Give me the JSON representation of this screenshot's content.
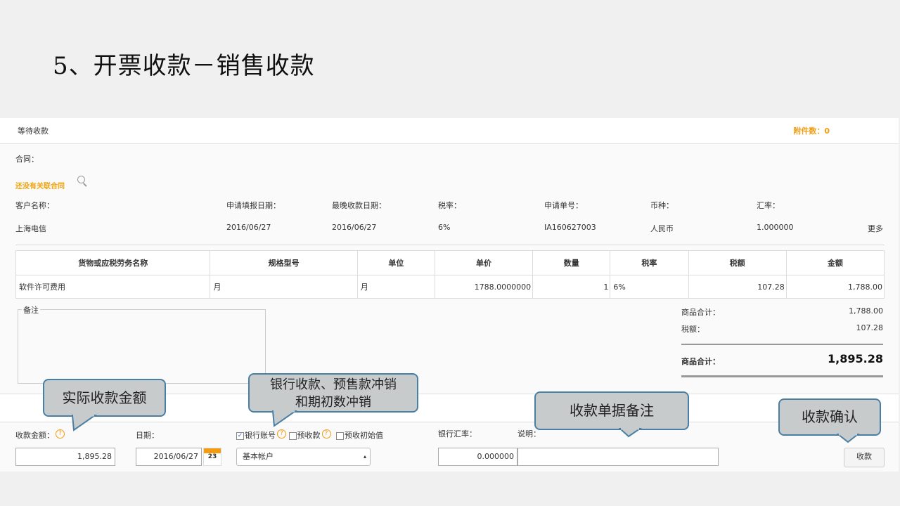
{
  "slide": {
    "title": "5、开票收款－销售收款"
  },
  "header": {
    "status": "等待收款",
    "attachments": "附件数：0"
  },
  "contract": {
    "label": "合同：",
    "link": "还没有关联合同"
  },
  "info": {
    "labels": [
      "客户名称：",
      "申请填报日期：",
      "最晚收款日期：",
      "税率：",
      "申请单号：",
      "币种：",
      "汇率："
    ],
    "values": [
      "上海电信",
      "2016/06/27",
      "2016/06/27",
      "6%",
      "IA160627003",
      "人民币",
      "1.000000"
    ],
    "more": "更多"
  },
  "table": {
    "headers": [
      "货物或应税劳务名称",
      "规格型号",
      "单位",
      "单价",
      "数量",
      "税率",
      "税额",
      "金额"
    ],
    "rows": [
      [
        "软件许可费用",
        "月",
        "月",
        "1788.0000000",
        "1",
        "6%",
        "107.28",
        "1,788.00"
      ]
    ]
  },
  "memo": {
    "label": "备注"
  },
  "summary": {
    "goods_label": "商品合计：",
    "goods_value": "1,788.00",
    "tax_label": "税额：",
    "tax_value": "107.28",
    "total_label": "商品合计：",
    "total_value": "1,895.28"
  },
  "form": {
    "amount_label": "收款金额：",
    "amount_value": "1,895.28",
    "date_label": "日期：",
    "date_value": "2016/06/27",
    "cal_day": "23",
    "bank_account_label": "银行账号",
    "presale_label": "预收款",
    "initial_label": "预收初始值",
    "account_select": "基本帐户",
    "rate_label": "银行汇率：",
    "rate_value": "0.000000",
    "note_label": "说明：",
    "note_value": "",
    "submit": "收款"
  },
  "callouts": {
    "amount": "实际收款金额",
    "bank_l1": "银行收款、预售款冲销",
    "bank_l2": "和期初数冲销",
    "memo": "收款单据备注",
    "confirm": "收款确认"
  }
}
